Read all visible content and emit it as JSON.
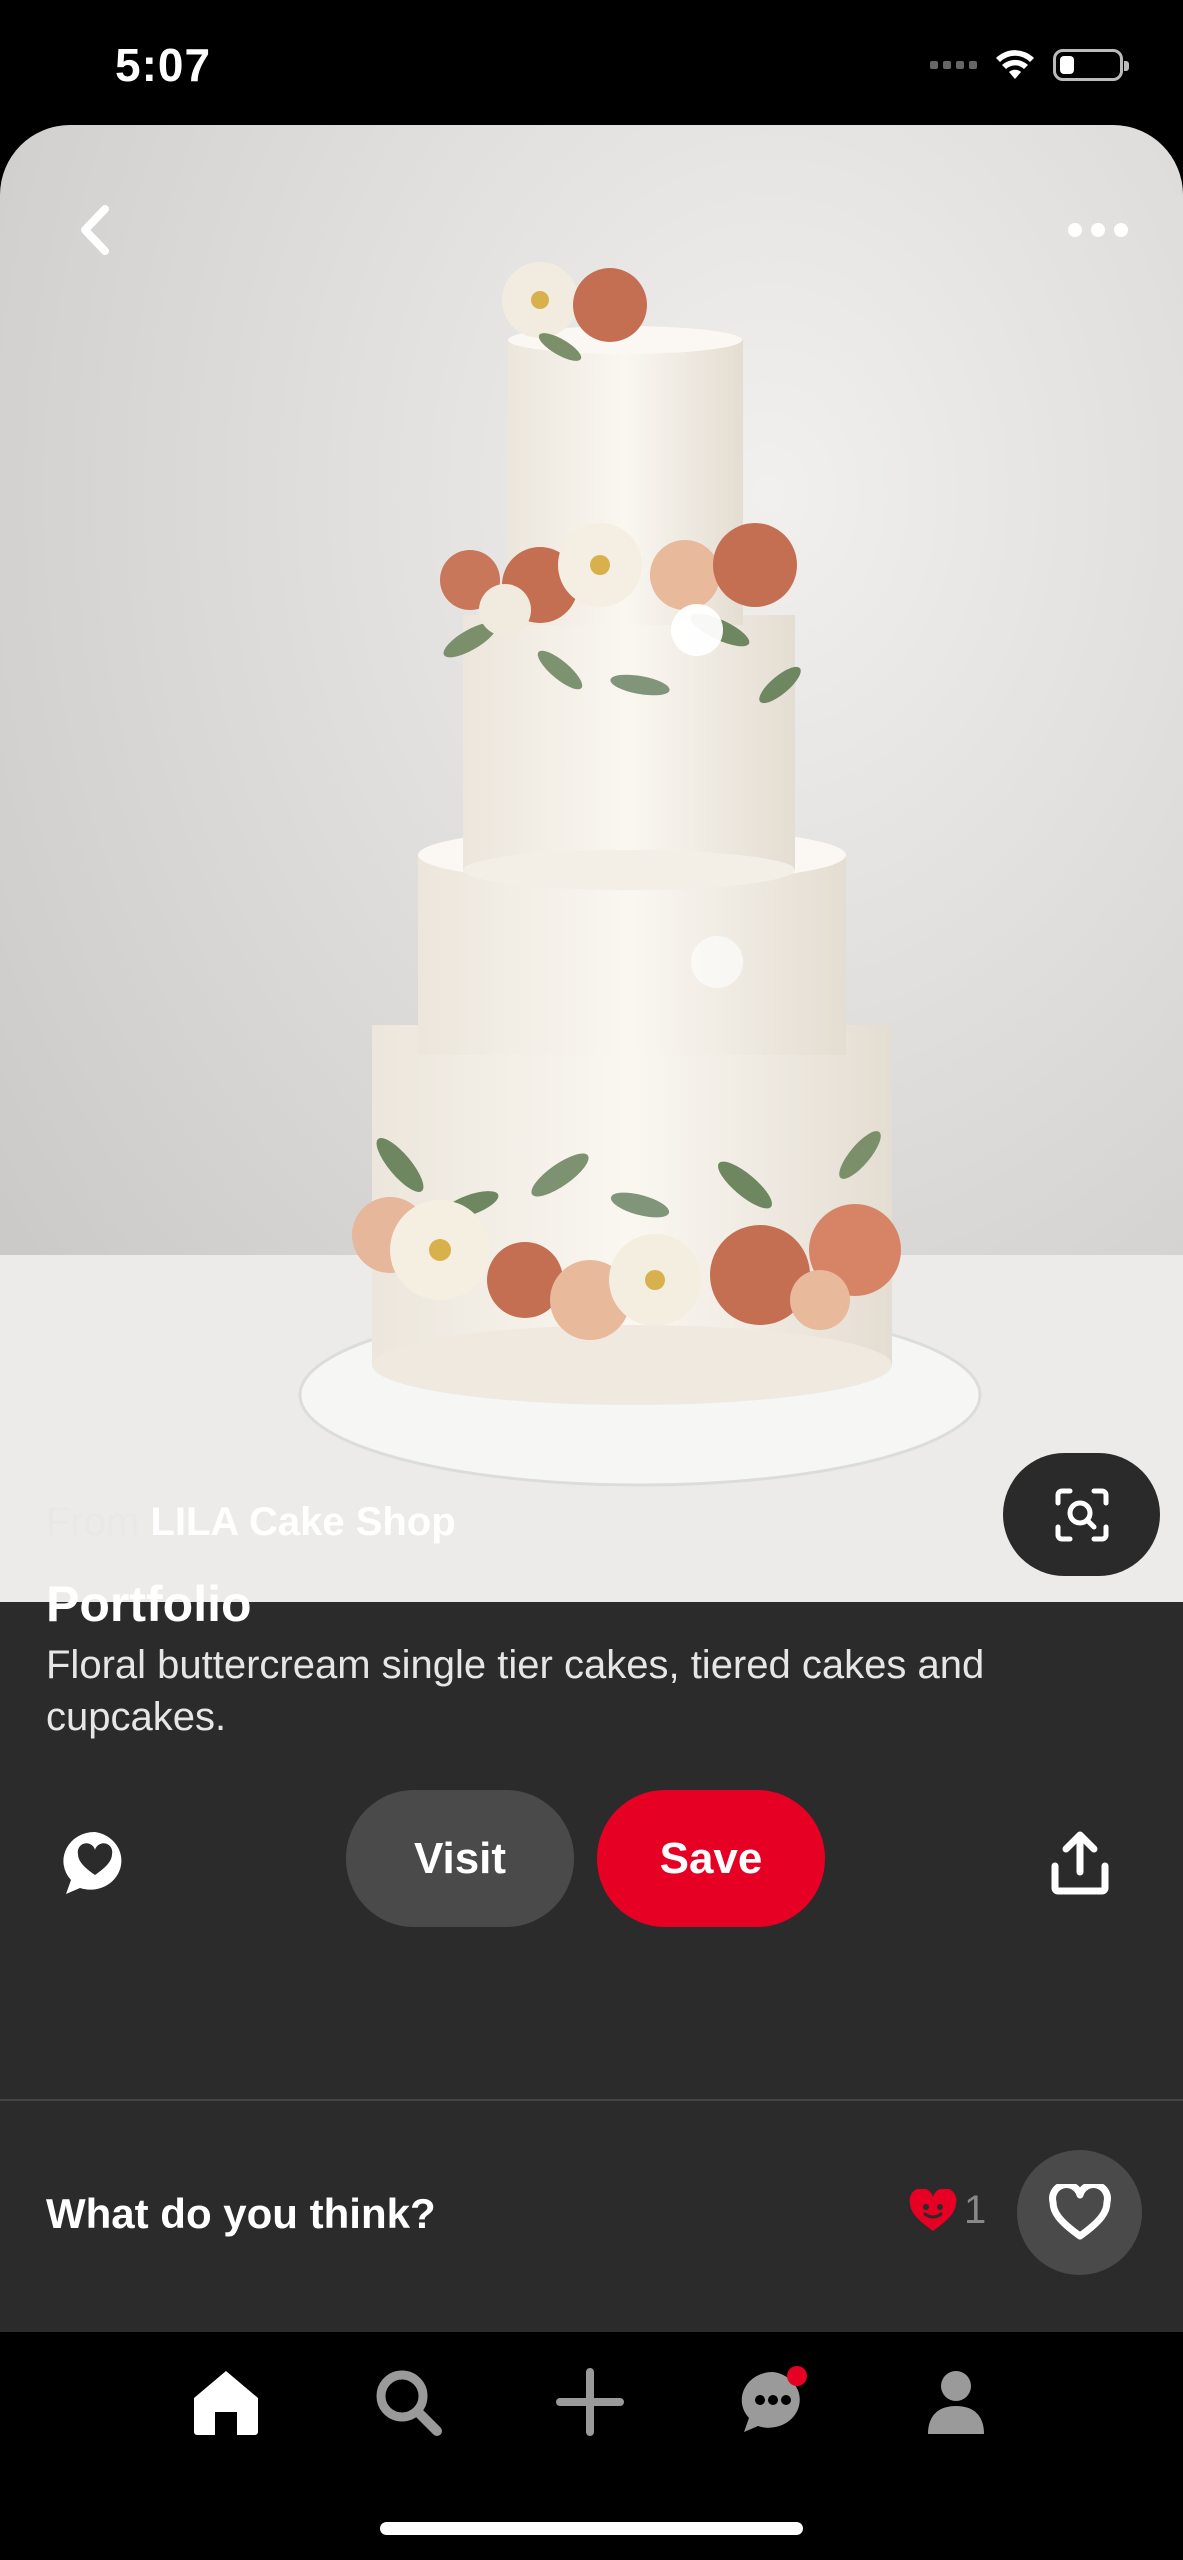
{
  "status_bar": {
    "time": "5:07"
  },
  "pin": {
    "source_prefix": "From",
    "source_name": "LILA Cake Shop",
    "title": "Portfolio",
    "description": "Floral buttercream single tier cakes, tiered cakes and cupcakes."
  },
  "actions": {
    "visit_label": "Visit",
    "save_label": "Save"
  },
  "feedback": {
    "prompt": "What do you think?",
    "reaction_count": "1"
  },
  "colors": {
    "accent": "#e60023",
    "surface": "#2b2b2b",
    "button_secondary": "#4a4a4a"
  },
  "icons": {
    "back": "chevron-left-icon",
    "more": "ellipsis-icon",
    "visual_search": "lens-search-icon",
    "comment": "comment-heart-icon",
    "share": "share-icon",
    "reaction": "heart-icon",
    "nav": [
      "home-icon",
      "search-icon",
      "plus-icon",
      "messages-icon",
      "profile-icon"
    ]
  }
}
